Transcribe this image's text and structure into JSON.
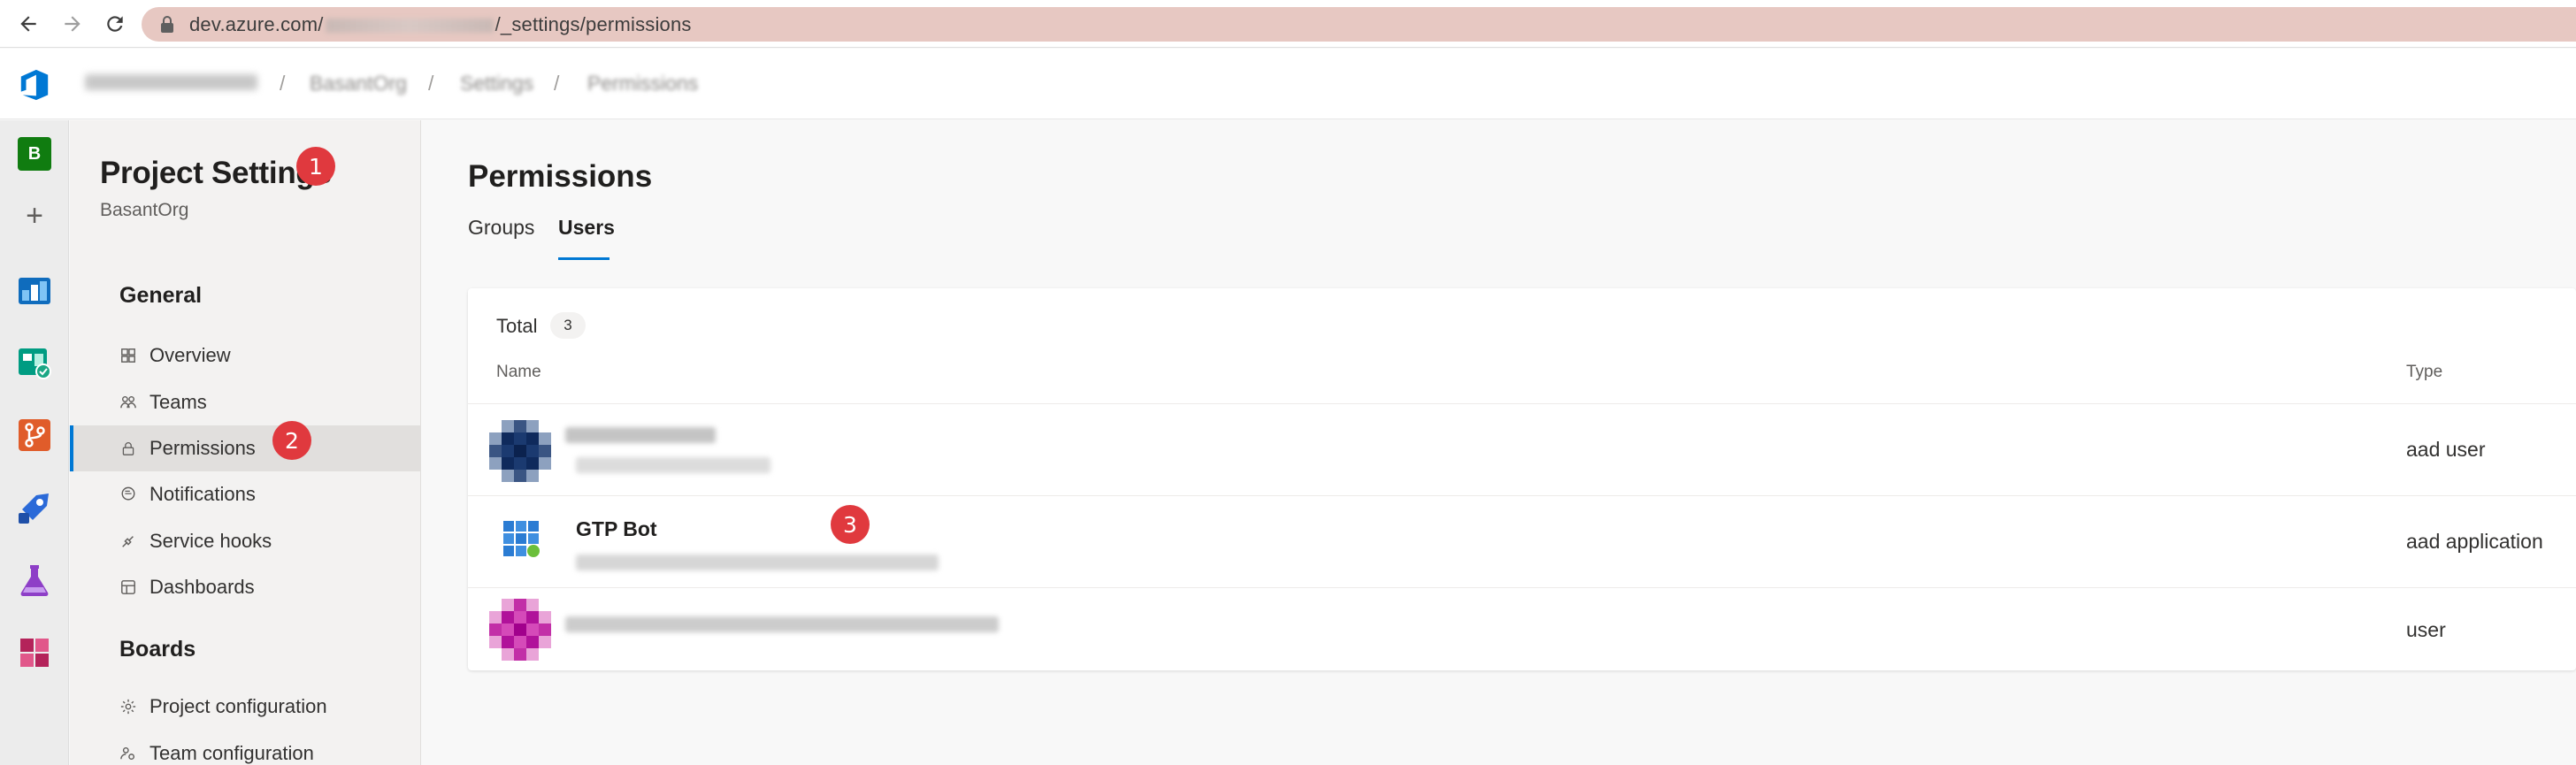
{
  "browser": {
    "url_prefix": "dev.azure.com/",
    "url_suffix": "/_settings/permissions"
  },
  "breadcrumbs": {
    "project": "BasantOrg",
    "settings": "Settings",
    "permissions": "Permissions",
    "separator": "/"
  },
  "rail": {
    "org_initial": "B",
    "add_symbol": "+",
    "icons": [
      "overview-icon",
      "boards-icon",
      "repos-icon",
      "pipelines-icon",
      "test-plans-icon",
      "artifacts-icon"
    ]
  },
  "sidebar": {
    "title": "Project Settings",
    "subtitle": "BasantOrg",
    "sections": [
      {
        "heading": "General",
        "items": [
          {
            "label": "Overview",
            "icon": "overview-icon"
          },
          {
            "label": "Teams",
            "icon": "teams-icon"
          },
          {
            "label": "Permissions",
            "icon": "lock-icon",
            "active": true
          },
          {
            "label": "Notifications",
            "icon": "chat-icon"
          },
          {
            "label": "Service hooks",
            "icon": "hook-icon"
          },
          {
            "label": "Dashboards",
            "icon": "dashboard-icon"
          }
        ]
      },
      {
        "heading": "Boards",
        "items": [
          {
            "label": "Project configuration",
            "icon": "gear-icon"
          },
          {
            "label": "Team configuration",
            "icon": "team-config-icon"
          }
        ]
      }
    ]
  },
  "main": {
    "title": "Permissions",
    "tabs": [
      {
        "label": "Groups",
        "selected": false
      },
      {
        "label": "Users",
        "selected": true
      }
    ],
    "total_label": "Total",
    "total_count": "3",
    "columns": {
      "name": "Name",
      "type": "Type"
    },
    "rows": [
      {
        "name": "",
        "type": "aad user"
      },
      {
        "name": "GTP Bot",
        "type": "aad application"
      },
      {
        "name": "",
        "type": "user"
      }
    ]
  },
  "annotations": [
    "1",
    "2",
    "3"
  ],
  "colors": {
    "accent": "#0078d4",
    "badge": "#e0393e",
    "org_avatar": "#107c10"
  }
}
